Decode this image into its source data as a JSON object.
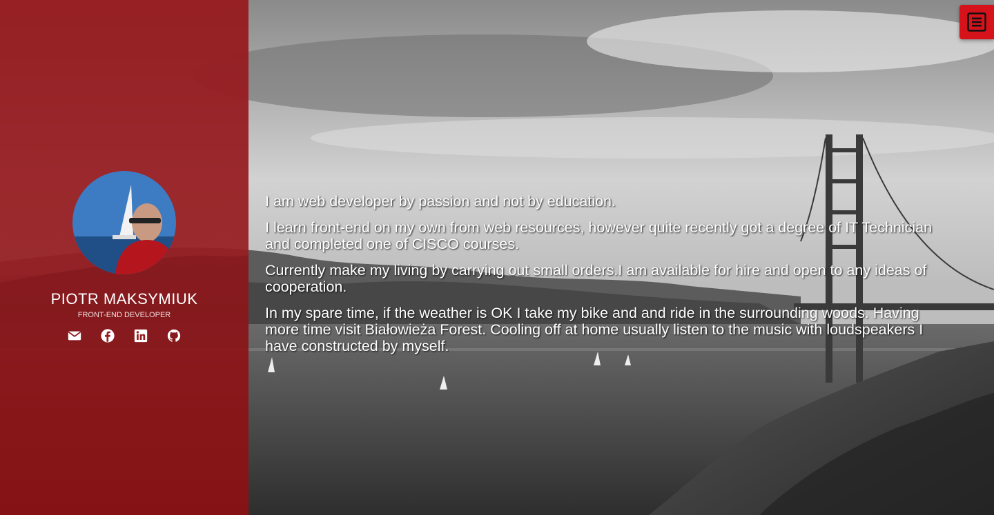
{
  "profile": {
    "name": "PIOTR MAKSYMIUK",
    "role": "FRONT-END DEVELOPER",
    "avatar_icon": "person-photo"
  },
  "social": [
    {
      "name": "email",
      "icon": "envelope-icon"
    },
    {
      "name": "facebook",
      "icon": "facebook-icon"
    },
    {
      "name": "linkedin",
      "icon": "linkedin-icon"
    },
    {
      "name": "github",
      "icon": "github-icon"
    }
  ],
  "about": {
    "paragraphs": [
      "I am web developer by passion and not by education.",
      "I learn front-end on my own from web resources, however quite recently got a degree of IT Technician and completed one of CISCO courses.",
      "Currently make my living by carrying out small orders.I am available for hire and open to any ideas of cooperation.",
      "In my spare time, if the weather is OK I take my bike and and ride in the surrounding woods. Having more time visit Białowieża Forest. Cooling off at home usually listen to the music with loudspeakers I have constructed by myself."
    ]
  },
  "menu": {
    "icon": "hamburger-menu-icon"
  },
  "colors": {
    "sidebar": "#961c20",
    "menu_button": "#d6121b",
    "text": "#ffffff"
  }
}
